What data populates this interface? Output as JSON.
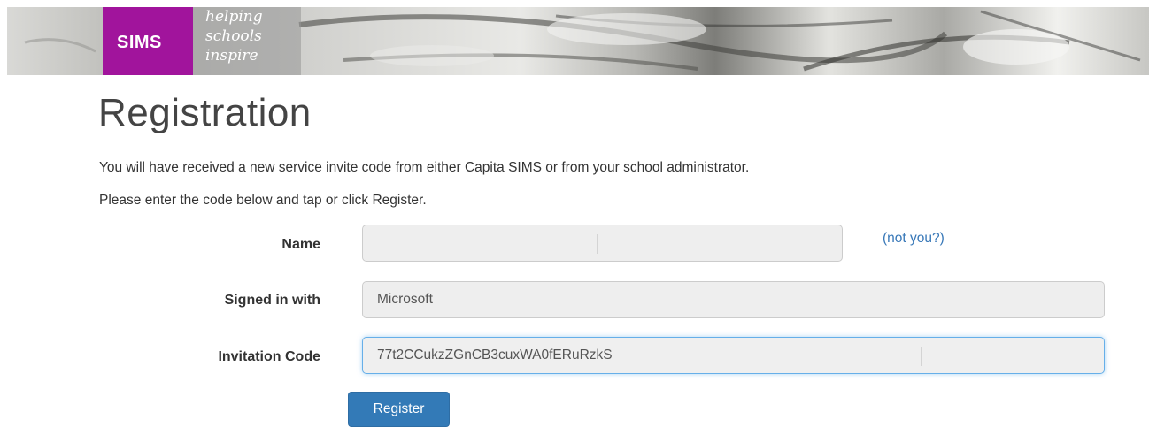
{
  "brand": {
    "name": "SIMS",
    "tagline": [
      "helping",
      "schools",
      "inspire"
    ]
  },
  "page": {
    "title": "Registration",
    "intro_1": "You will have received a new service invite code from either Capita SIMS or from your school administrator.",
    "intro_2": "Please enter the code below and tap or click Register."
  },
  "form": {
    "name_label": "Name",
    "name_value": "",
    "not_you_link": "(not you?)",
    "signed_in_label": "Signed in with",
    "signed_in_value": "Microsoft",
    "invitation_label": "Invitation Code",
    "invitation_value": "77t2CCukzZGnCB3cuxWA0fERuRzkS",
    "register_button": "Register"
  },
  "colors": {
    "brand_purple": "#a1149c",
    "button_blue": "#337ab7",
    "link_blue": "#3878b8"
  }
}
